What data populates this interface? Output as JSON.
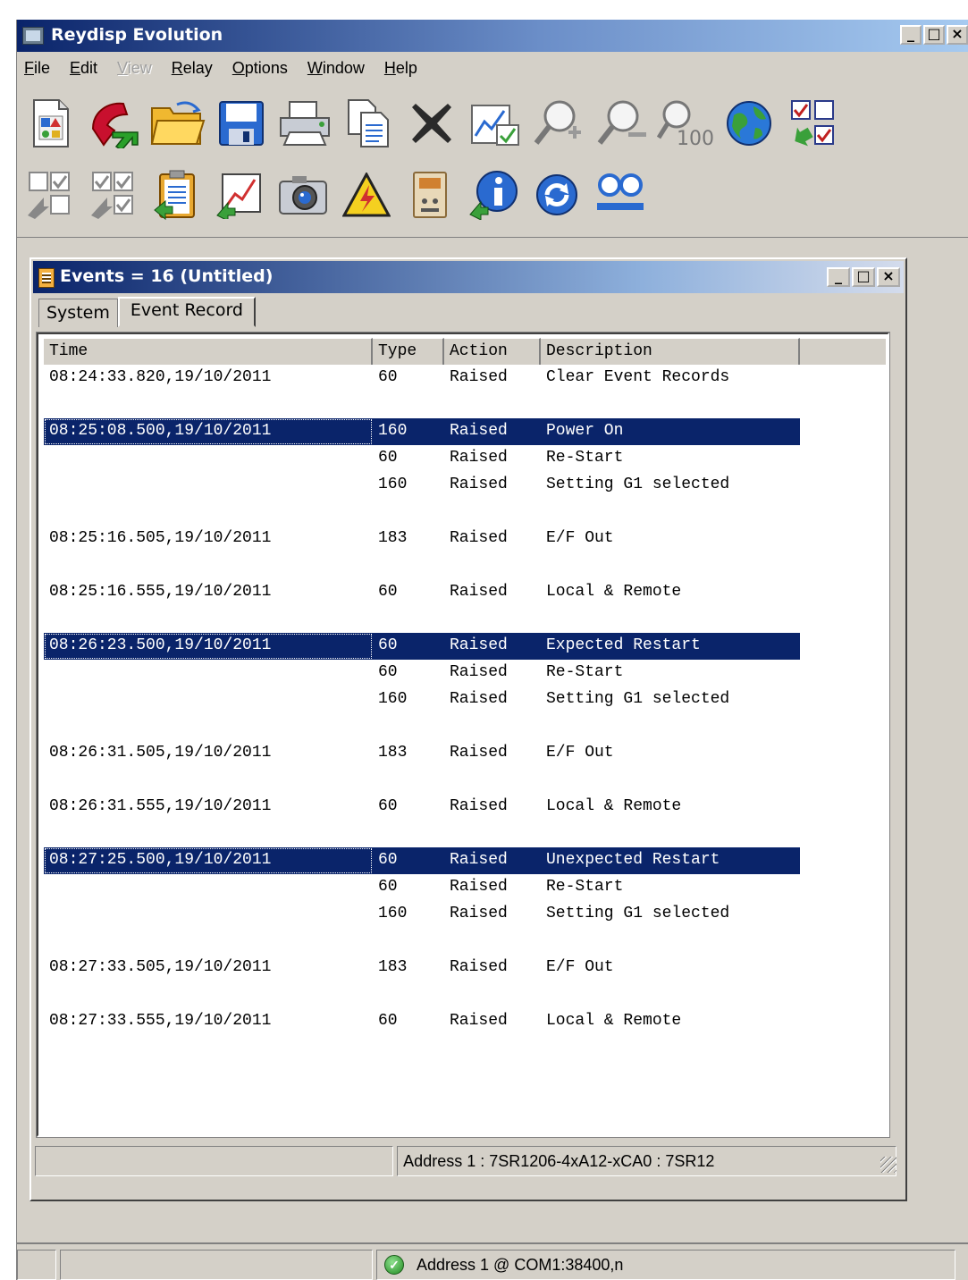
{
  "app": {
    "title": "Reydisp Evolution"
  },
  "window_buttons": {
    "minimize": "_",
    "maximize": "□",
    "close": "×"
  },
  "menu": [
    {
      "label": "File",
      "accel": "F",
      "rest": "ile",
      "disabled": false
    },
    {
      "label": "Edit",
      "accel": "E",
      "rest": "dit",
      "disabled": false
    },
    {
      "label": "View",
      "accel": "V",
      "rest": "iew",
      "disabled": true
    },
    {
      "label": "Relay",
      "accel": "R",
      "rest": "elay",
      "disabled": false
    },
    {
      "label": "Options",
      "accel": "O",
      "rest": "ptions",
      "disabled": false
    },
    {
      "label": "Window",
      "accel": "W",
      "rest": "indow",
      "disabled": false
    },
    {
      "label": "Help",
      "accel": "H",
      "rest": "elp",
      "disabled": false
    }
  ],
  "toolbar": {
    "row1": [
      "new-document-icon",
      "connect-phone-icon",
      "open-folder-icon",
      "save-disk-icon",
      "print-icon",
      "copy-icon",
      "delete-icon",
      "chart-check-icon",
      "zoom-in-icon",
      "zoom-out-icon",
      "zoom-100-icon",
      "globe-icon",
      "select-checks-icon"
    ],
    "row2": [
      "deselect-icon",
      "select-all-icon",
      "clipboard-list-icon",
      "graph-export-icon",
      "camera-icon",
      "warning-icon",
      "relay-device-icon",
      "info-icon",
      "refresh-icon",
      "users-icon"
    ],
    "zoom_100_label": "100"
  },
  "events_window": {
    "title": "Events = 16 (Untitled)",
    "tabs": [
      {
        "label": "System",
        "active": false
      },
      {
        "label": "Event Record",
        "active": true
      }
    ],
    "columns": [
      "Time",
      "Type",
      "Action",
      "Description"
    ],
    "rows": [
      {
        "time": "08:24:33.820,19/10/2011",
        "type": "60",
        "action": "Raised",
        "description": "Clear Event Records",
        "selected": false
      },
      {
        "time": "",
        "type": "",
        "action": "",
        "description": "",
        "selected": false
      },
      {
        "time": "08:25:08.500,19/10/2011",
        "type": "160",
        "action": "Raised",
        "description": "Power On",
        "selected": true
      },
      {
        "time": "",
        "type": "60",
        "action": "Raised",
        "description": "Re-Start",
        "selected": false
      },
      {
        "time": "",
        "type": "160",
        "action": "Raised",
        "description": "Setting G1 selected",
        "selected": false
      },
      {
        "time": "",
        "type": "",
        "action": "",
        "description": "",
        "selected": false
      },
      {
        "time": "08:25:16.505,19/10/2011",
        "type": "183",
        "action": "Raised",
        "description": "E/F Out",
        "selected": false
      },
      {
        "time": "",
        "type": "",
        "action": "",
        "description": "",
        "selected": false
      },
      {
        "time": "08:25:16.555,19/10/2011",
        "type": "60",
        "action": "Raised",
        "description": "Local & Remote",
        "selected": false
      },
      {
        "time": "",
        "type": "",
        "action": "",
        "description": "",
        "selected": false
      },
      {
        "time": "08:26:23.500,19/10/2011",
        "type": "60",
        "action": "Raised",
        "description": "Expected Restart",
        "selected": true
      },
      {
        "time": "",
        "type": "60",
        "action": "Raised",
        "description": "Re-Start",
        "selected": false
      },
      {
        "time": "",
        "type": "160",
        "action": "Raised",
        "description": "Setting G1 selected",
        "selected": false
      },
      {
        "time": "",
        "type": "",
        "action": "",
        "description": "",
        "selected": false
      },
      {
        "time": "08:26:31.505,19/10/2011",
        "type": "183",
        "action": "Raised",
        "description": "E/F Out",
        "selected": false
      },
      {
        "time": "",
        "type": "",
        "action": "",
        "description": "",
        "selected": false
      },
      {
        "time": "08:26:31.555,19/10/2011",
        "type": "60",
        "action": "Raised",
        "description": "Local & Remote",
        "selected": false
      },
      {
        "time": "",
        "type": "",
        "action": "",
        "description": "",
        "selected": false
      },
      {
        "time": "08:27:25.500,19/10/2011",
        "type": "60",
        "action": "Raised",
        "description": "Unexpected Restart",
        "selected": true
      },
      {
        "time": "",
        "type": "60",
        "action": "Raised",
        "description": "Re-Start",
        "selected": false
      },
      {
        "time": "",
        "type": "160",
        "action": "Raised",
        "description": "Setting G1 selected",
        "selected": false
      },
      {
        "time": "",
        "type": "",
        "action": "",
        "description": "",
        "selected": false
      },
      {
        "time": "08:27:33.505,19/10/2011",
        "type": "183",
        "action": "Raised",
        "description": "E/F Out",
        "selected": false
      },
      {
        "time": "",
        "type": "",
        "action": "",
        "description": "",
        "selected": false
      },
      {
        "time": "08:27:33.555,19/10/2011",
        "type": "60",
        "action": "Raised",
        "description": "Local & Remote",
        "selected": false
      }
    ],
    "status": {
      "left": "",
      "address": "Address 1 : 7SR1206-4xA12-xCA0 : 7SR12"
    }
  },
  "main_status": {
    "pane1": "",
    "pane2": "",
    "connection": "Address 1  @ COM1:38400,n"
  },
  "colors": {
    "selection": "#0a246a",
    "titlebar": "#0a246a",
    "face": "#d4d0c8"
  }
}
